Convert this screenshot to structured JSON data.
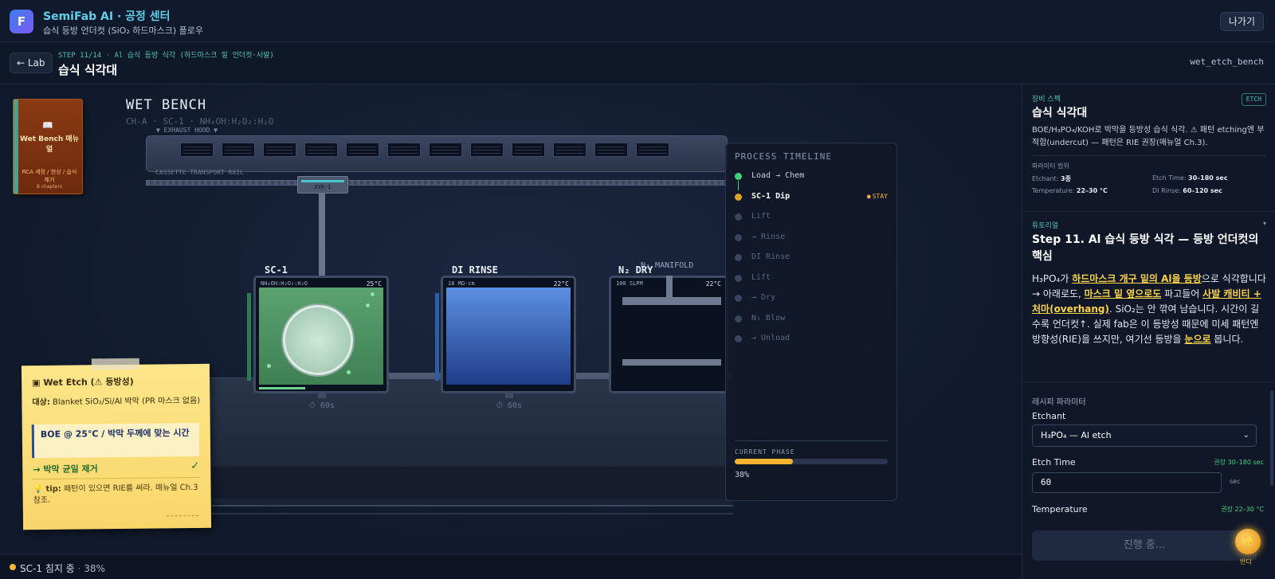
{
  "app": {
    "logo_letter": "F",
    "title": "SemiFab AI · 공정 센터",
    "subtitle": "습식 등방 언더컷 (SiO₂ 하드마스크) 플로우",
    "exit_label": "나가기"
  },
  "step": {
    "back_label": "← Lab",
    "label": "STEP 11/14 · Al 습식 등방 식각 (하드마스크 밑 언더컷·사발)",
    "title": "습식 식각대",
    "id": "wet_etch_bench"
  },
  "manual": {
    "glyph": "📖",
    "title": "Wet Bench 매뉴얼",
    "desc": "RCA 세정 / 현상 / 습식 제거",
    "chapters": "8 chapters"
  },
  "bench": {
    "title": "WET BENCH",
    "subtitle": "CH-A · SC-1 · NH₄OH:H₂O₂:H₂O",
    "exhaust_label": "▼ EXHAUST HOOD ▼",
    "rail_label": "CASSETTE TRANSPORT RAIL",
    "robot_label": "XYR-1",
    "manifold_label": "N₂ MANIFOLD",
    "tanks": [
      {
        "label": "SC-1",
        "info": "NH₄OH:H₂O₂:H₂O",
        "temp": "25°C",
        "timer": "⏱ 60s",
        "progress": 0.38
      },
      {
        "label": "DI RINSE",
        "info": "18 MΩ·cm",
        "temp": "22°C",
        "timer": "⏱ 60s"
      },
      {
        "label": "N₂ DRY",
        "info": "100 SLPM",
        "temp": "22°C"
      }
    ]
  },
  "timeline": {
    "title": "PROCESS TIMELINE",
    "items": [
      {
        "label": "Load → Chem",
        "state": "done"
      },
      {
        "label": "SC-1 Dip",
        "state": "active"
      },
      {
        "label": "Lift",
        "state": "pending"
      },
      {
        "label": "→ Rinse",
        "state": "pending"
      },
      {
        "label": "DI Rinse",
        "state": "pending"
      },
      {
        "label": "Lift",
        "state": "pending"
      },
      {
        "label": "→ Dry",
        "state": "pending"
      },
      {
        "label": "N₂ Blow",
        "state": "pending"
      },
      {
        "label": "→ Unload",
        "state": "pending"
      }
    ],
    "stay_label": "STAY",
    "current_phase_label": "CURRENT PHASE",
    "progress": 38,
    "progress_text": "38%"
  },
  "sticky": {
    "title": "▣ Wet Etch (⚠ 등방성)",
    "target_label": "대상:",
    "target_value": "Blanket SiO₂/Si/Al 박막 (PR 마스크 없음)",
    "box": "BOE @ 25℃ / 박막 두께에 맞는 시간",
    "result": "→ 박막 균일 제거",
    "check": "✓",
    "tip_label": "💡 tip:",
    "tip_text": "패턴이 있으면 RIE를 써라. 매뉴얼 Ch.3 참조."
  },
  "status": {
    "text": "SC-1 침지 중",
    "separator": "·",
    "percent": "38%"
  },
  "equipment": {
    "label": "장비 스펙",
    "title": "습식 식각대",
    "badge": "ETCH",
    "desc": "BOE/H₃PO₄/KOH로 박막을 등방성 습식 식각. ⚠ 패턴 etching엔 부적합(undercut) — 패턴은 RIE 권장(매뉴얼 Ch.3).",
    "range_label": "파라미터 범위",
    "specs": [
      {
        "key": "Etchant:",
        "value": "3종"
      },
      {
        "key": "Etch Time:",
        "value": "30–180 sec"
      },
      {
        "key": "Temperature:",
        "value": "22–30 °C"
      },
      {
        "key": "DI Rinse:",
        "value": "60–120 sec"
      }
    ]
  },
  "tutorial": {
    "label": "튜토리얼",
    "caret": "▾",
    "title": "Step 11. Al 습식 등방 식각 — 등방 언더컷의 핵심",
    "p1": "H₃PO₄가 ",
    "h1": "하드마스크 개구 밑의 Al을 등방",
    "p2": "으로 식각합니다 → 아래로도, ",
    "h2": "마스크 밑 옆으로도",
    "p3": " 파고들어 ",
    "h3": "사발 캐비티 + 처마(overhang)",
    "p4": ". SiO₂는 안 깎여 남습니다. 시간이 길수록 언더컷↑. 실제 fab은 이 등방성 때문에 미세 패턴엔 방향성(RIE)을 쓰지만, 여기선 등방을 ",
    "h4": "눈으로",
    "p5": " 봅니다."
  },
  "recipe": {
    "label": "레시피 파라미터",
    "etchant_label": "Etchant",
    "etchant_value": "H₃PO₄ — Al etch",
    "etch_time_label": "Etch Time",
    "etch_time_hint": "권장 30–180 sec",
    "etch_time_value": "60",
    "etch_time_unit": "sec",
    "temp_label": "Temperature",
    "temp_hint": "권장 22–30 °C",
    "run_label": "진행 중..."
  },
  "companion": {
    "glyph": "✨",
    "label": "반디"
  },
  "colors": {
    "accent": "#4fc3b8",
    "highlight": "#fbd34a",
    "done": "#3fd27a",
    "active": "#e0a12a"
  }
}
